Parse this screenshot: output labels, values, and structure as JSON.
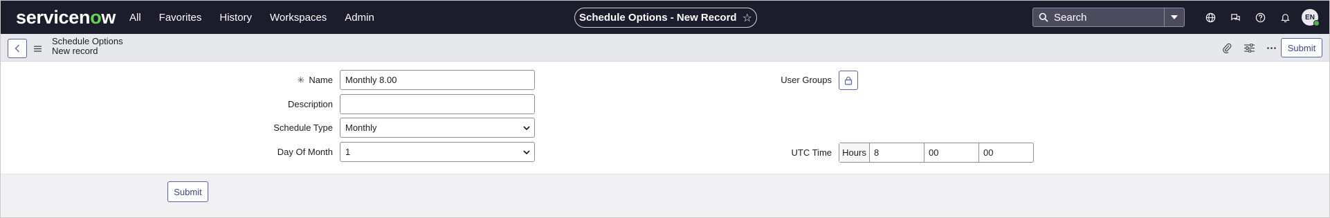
{
  "topnav": {
    "logo_prefix": "servicen",
    "logo_o": "o",
    "logo_suffix": "w",
    "menu": [
      "All",
      "Favorites",
      "History",
      "Workspaces",
      "Admin"
    ],
    "record_title": "Schedule Options - New Record",
    "search_label": "Search",
    "avatar_initials": "EN",
    "icons": [
      "globe-icon",
      "chat-icon",
      "help-icon",
      "bell-icon"
    ]
  },
  "formbar": {
    "table_name": "Schedule Options",
    "record_state": "New record",
    "submit_label": "Submit",
    "icons": [
      "paperclip-icon",
      "settings-sliders-icon",
      "more-icon"
    ]
  },
  "form": {
    "name": {
      "label": "Name",
      "required_mark": "✳",
      "value": "Monthly 8.00"
    },
    "description": {
      "label": "Description",
      "value": ""
    },
    "schedule_type": {
      "label": "Schedule Type",
      "value": "Monthly"
    },
    "day_of_month": {
      "label": "Day Of Month",
      "value": "1"
    },
    "user_groups": {
      "label": "User Groups"
    },
    "utc_time": {
      "label": "UTC Time",
      "unit_label": "Hours",
      "hours": "8",
      "minutes": "00",
      "seconds": "00"
    },
    "submit_label": "Submit"
  },
  "colors": {
    "nav_bg": "#1b1c2c",
    "accent": "#5a62a8",
    "logo_green": "#62d84e"
  }
}
